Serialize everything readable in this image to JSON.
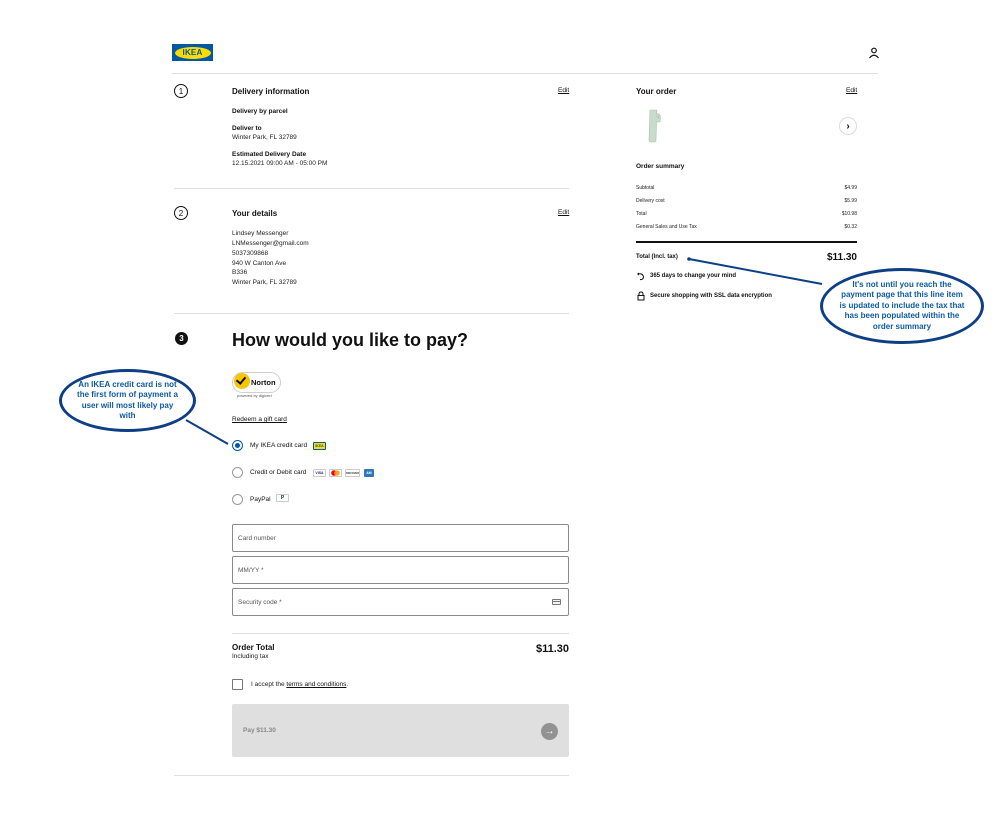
{
  "header": {
    "logo_text": "IKEA"
  },
  "delivery": {
    "step": "1",
    "title": "Delivery information",
    "edit_label": "Edit",
    "method": "Delivery by parcel",
    "deliver_to_label": "Deliver to",
    "deliver_to_value": "Winter Park, FL 32789",
    "est_date_label": "Estimated Delivery Date",
    "est_date_value": "12.15.2021 09:00 AM - 05:00 PM"
  },
  "details": {
    "step": "2",
    "title": "Your details",
    "edit_label": "Edit",
    "lines": [
      "Lindsey Messenger",
      "LNMessenger@gmail.com",
      "5037309868",
      "940 W Canton Ave",
      "B336",
      "Winter Park, FL 32789"
    ]
  },
  "payment": {
    "step": "3",
    "title": "How would you like to pay?",
    "norton_name": "Norton",
    "norton_sub": "powered by digicert",
    "redeem_label": "Redeem a gift card",
    "methods": [
      {
        "label": "My IKEA credit card",
        "selected": true
      },
      {
        "label": "Credit or Debit card",
        "selected": false
      },
      {
        "label": "PayPal",
        "selected": false
      }
    ],
    "badges": {
      "ikea": "IKEA",
      "visa": "VISA",
      "mastercard": "MC",
      "discover": "DISCOVER",
      "amex": "AM",
      "paypal": "P"
    },
    "card_number_placeholder": "Card number",
    "expiry_placeholder": "MM/YY *",
    "security_placeholder": "Security code *",
    "order_total_label": "Order Total",
    "order_total_sub": "Including tax",
    "order_total_value": "$11.30",
    "accept_prefix": "I accept the",
    "accept_link": "terms and conditions",
    "accept_suffix": ".",
    "pay_button_label": "Pay $11.30"
  },
  "order": {
    "title": "Your order",
    "edit_label": "Edit",
    "summary_title": "Order summary",
    "rows": [
      {
        "label": "Subtotal",
        "value": "$4.99"
      },
      {
        "label": "Delivery cost",
        "value": "$5.99"
      },
      {
        "label": "Total",
        "value": "$10.98"
      },
      {
        "label": "General Sales and Use Tax",
        "value": "$0.32"
      }
    ],
    "total_label": "Total (Incl. tax)",
    "total_value": "$11.30",
    "perks": [
      "365 days to change your mind",
      "Secure shopping with SSL data encryption"
    ]
  },
  "annotations": {
    "right": "It's not until you reach the payment page that this line item is updated to include the tax that has been populated within the order summary",
    "left": "An IKEA credit card is not the first form of payment a user will most likely pay with"
  },
  "colors": {
    "ikea_blue": "#0058a3",
    "ikea_yellow": "#ffdb00",
    "annotation_border": "#0d3f84",
    "annotation_text": "#0d5aa3"
  }
}
